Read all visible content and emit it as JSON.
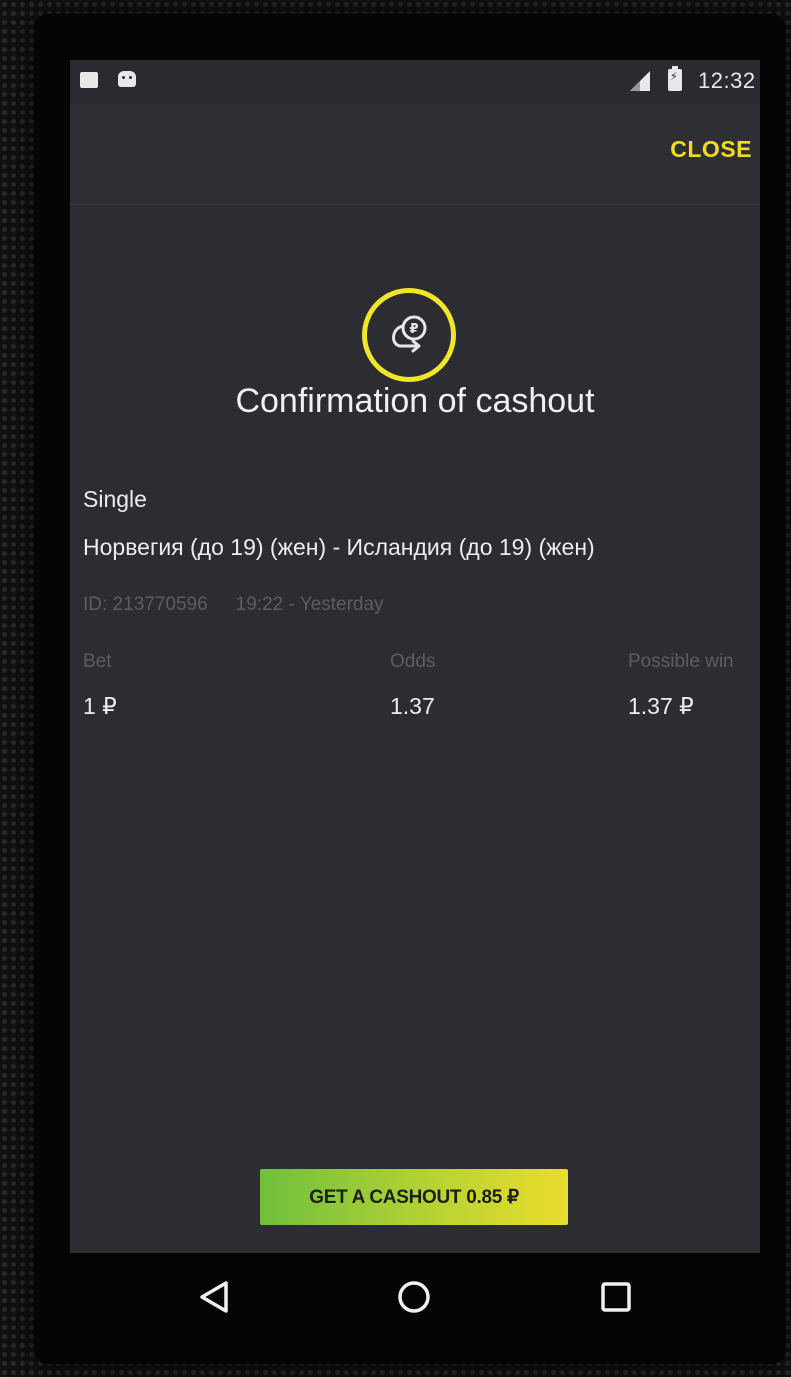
{
  "status_bar": {
    "time": "12:32",
    "icons": [
      "notification-square-icon",
      "android-icon",
      "signal-icon",
      "battery-charging-icon"
    ]
  },
  "app_bar": {
    "close_label": "CLOSE"
  },
  "hero": {
    "icon": "cashout-coin-icon",
    "accent_color": "#f0e628",
    "title": "Confirmation of cashout"
  },
  "bet": {
    "type": "Single",
    "event": "Норвегия (до 19) (жен) - Исландия (до 19) (жен)",
    "id": "ID: 213770596",
    "time": "19:22 - Yesterday",
    "columns": [
      {
        "label": "Bet",
        "value": "1 ₽"
      },
      {
        "label": "Odds",
        "value": "1.37"
      },
      {
        "label": "Possible win",
        "value": "1.37 ₽"
      }
    ]
  },
  "action": {
    "cashout_label": "GET A CASHOUT 0.85 ₽",
    "gradient_start": "#6fbf3e",
    "gradient_end": "#eadd2c"
  },
  "nav_bar": {
    "buttons": [
      "back-icon",
      "home-icon",
      "recents-icon"
    ]
  },
  "colors": {
    "screen_bg": "#2c2d33",
    "accent": "#f2dc20",
    "muted_text": "#5c5d63"
  }
}
